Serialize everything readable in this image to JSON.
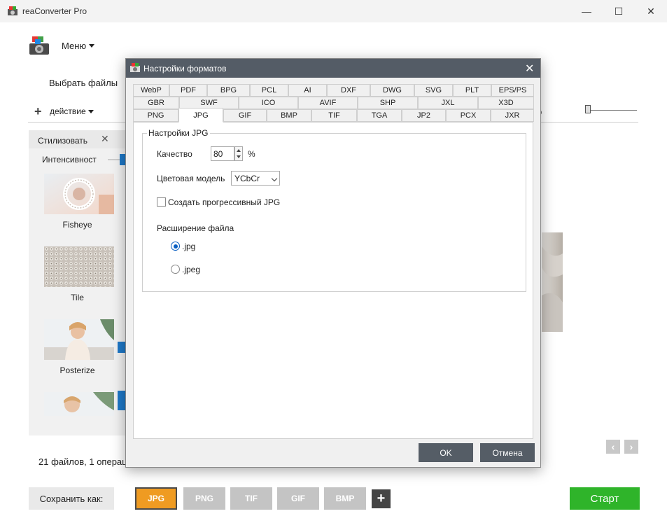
{
  "window": {
    "title": "reaConverter Pro",
    "min": "—",
    "max": "☐",
    "close": "✕"
  },
  "menu": {
    "label": "Меню"
  },
  "toolbar": {
    "select_files": "Выбрать файлы",
    "action": "действие",
    "filter_partial": "тр"
  },
  "left_panel": {
    "tab_label": "Стилизовать",
    "intensity_label": "Интенсивност",
    "effects": [
      "Fisheye",
      "Tile",
      "Posterize"
    ]
  },
  "status": {
    "text": "21 файлов, 1 операци"
  },
  "bottom": {
    "save_as": "Сохранить как:",
    "formats": [
      "JPG",
      "PNG",
      "TIF",
      "GIF",
      "BMP"
    ],
    "active_format": "JPG",
    "add": "+",
    "start": "Старт"
  },
  "nav": {
    "prev": "‹",
    "next": "›"
  },
  "dialog": {
    "title": "Настройки форматов",
    "tabs_row1": [
      "WebP",
      "PDF",
      "BPG",
      "PCL",
      "AI",
      "DXF",
      "DWG",
      "SVG",
      "PLT",
      "EPS/PS"
    ],
    "tabs_row2": [
      "GBR",
      "SWF",
      "ICO",
      "AVIF",
      "SHP",
      "JXL",
      "X3D"
    ],
    "tabs_row3": [
      "PNG",
      "JPG",
      "GIF",
      "BMP",
      "TIF",
      "TGA",
      "JP2",
      "PCX",
      "JXR"
    ],
    "active_tab": "JPG",
    "group_title": "Настройки JPG",
    "quality_label": "Качество",
    "quality_value": "80",
    "quality_unit": "%",
    "color_model_label": "Цветовая модель",
    "color_model_value": "YCbCr",
    "progressive_label": "Создать прогрессивный JPG",
    "progressive_checked": false,
    "extension_label": "Расширение файла",
    "extension_options": [
      ".jpg",
      ".jpeg"
    ],
    "extension_selected": ".jpg",
    "ok": "OK",
    "cancel": "Отмена"
  },
  "colors": {
    "accent": "#1e78c8",
    "active_format": "#ef9b22",
    "start": "#2fb42a",
    "dialog_title": "#545c66"
  }
}
